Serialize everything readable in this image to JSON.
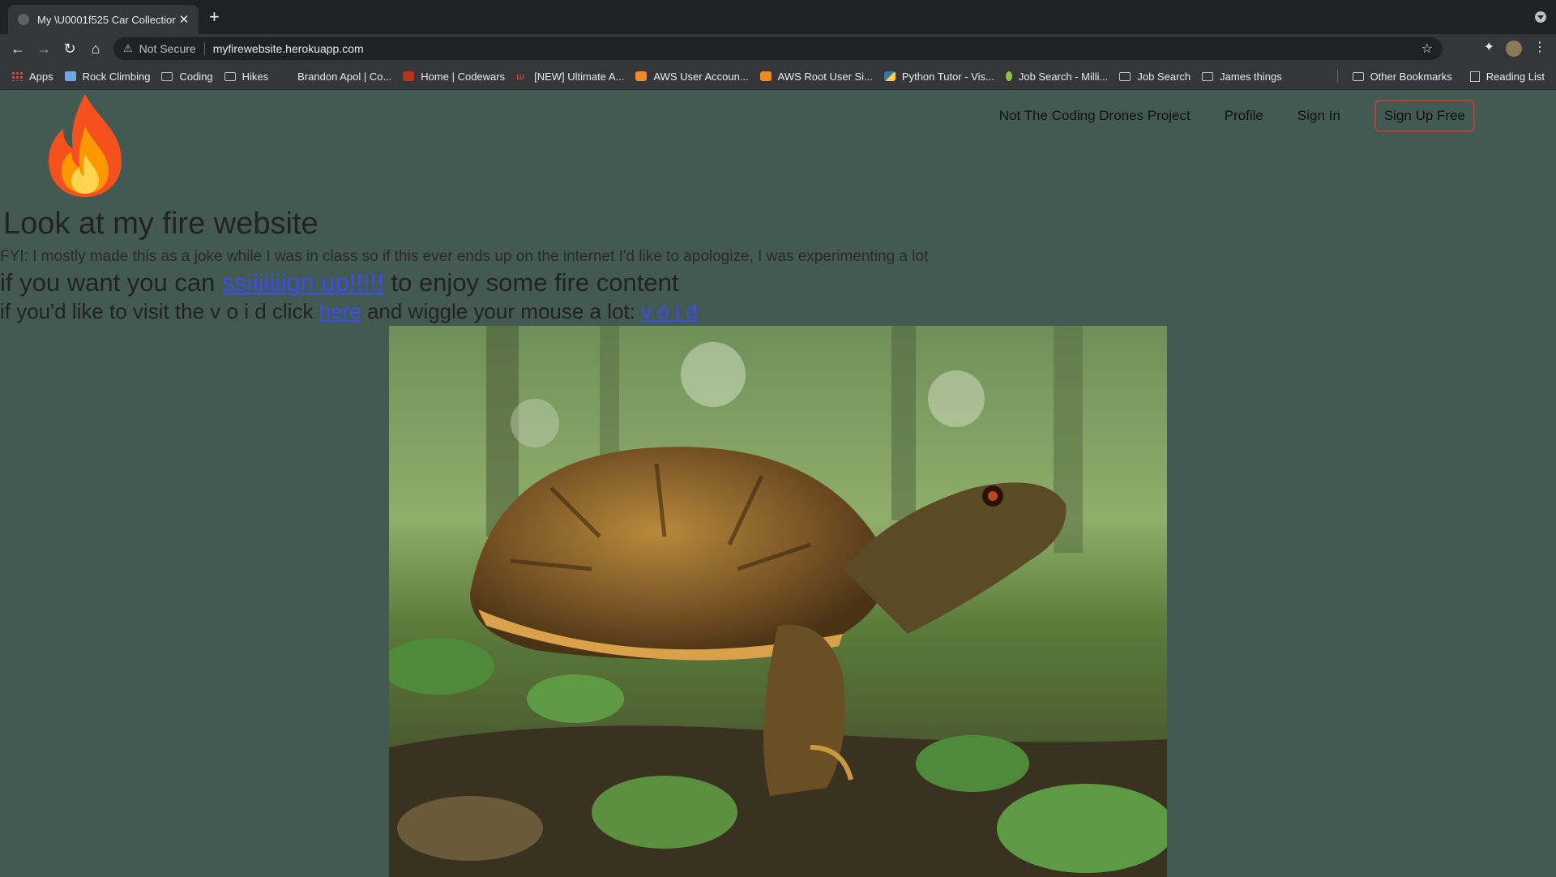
{
  "browser": {
    "tab_title": "My \\U0001f525 Car Collection",
    "tab_close": "✕",
    "new_tab": "+",
    "security_label": "Not Secure",
    "url": "myfirewebsite.herokuapp.com",
    "bookmarks": [
      {
        "label": "Apps",
        "icon": "apps-grid-icon"
      },
      {
        "label": "Rock Climbing",
        "icon": "site-icon"
      },
      {
        "label": "Coding",
        "icon": "folder-icon"
      },
      {
        "label": "Hikes",
        "icon": "folder-icon"
      },
      {
        "label": "Brandon Apol | Co...",
        "icon": "site-icon"
      },
      {
        "label": "Home | Codewars",
        "icon": "codewars-icon"
      },
      {
        "label": "[NEW] Ultimate A...",
        "icon": "site-icon"
      },
      {
        "label": "AWS User Accoun...",
        "icon": "aws-icon"
      },
      {
        "label": "AWS Root User Si...",
        "icon": "aws-icon"
      },
      {
        "label": "Python Tutor - Vis...",
        "icon": "python-icon"
      },
      {
        "label": "Job Search - Milli...",
        "icon": "site-icon"
      },
      {
        "label": "Job Search",
        "icon": "folder-icon"
      },
      {
        "label": "James things",
        "icon": "folder-icon"
      }
    ],
    "other_bookmarks": "Other Bookmarks",
    "reading_list": "Reading List"
  },
  "site": {
    "nav": {
      "project": "Not The Coding Drones Project",
      "profile": "Profile",
      "sign_in": "Sign In",
      "sign_up": "Sign Up Free"
    },
    "heading": "Look at my fire website",
    "fyi": "FYI: I mostly made this as a joke while I was in class so if this ever ends up on the internet I'd like to apologize, I was experimenting a lot",
    "line2_pre": "if you want you can ",
    "line2_link": "ssiiiiiiign up!!!!!",
    "line2_post": " to enjoy some fire content",
    "line3_pre": "if you'd like to visit the v o i d click ",
    "line3_link1": "here",
    "line3_mid": " and wiggle your mouse a lot: ",
    "line3_link2": "v o i d"
  },
  "colors": {
    "page_bg": "#435a53",
    "link": "#3a4cf0",
    "signup_border": "#b3413b"
  }
}
